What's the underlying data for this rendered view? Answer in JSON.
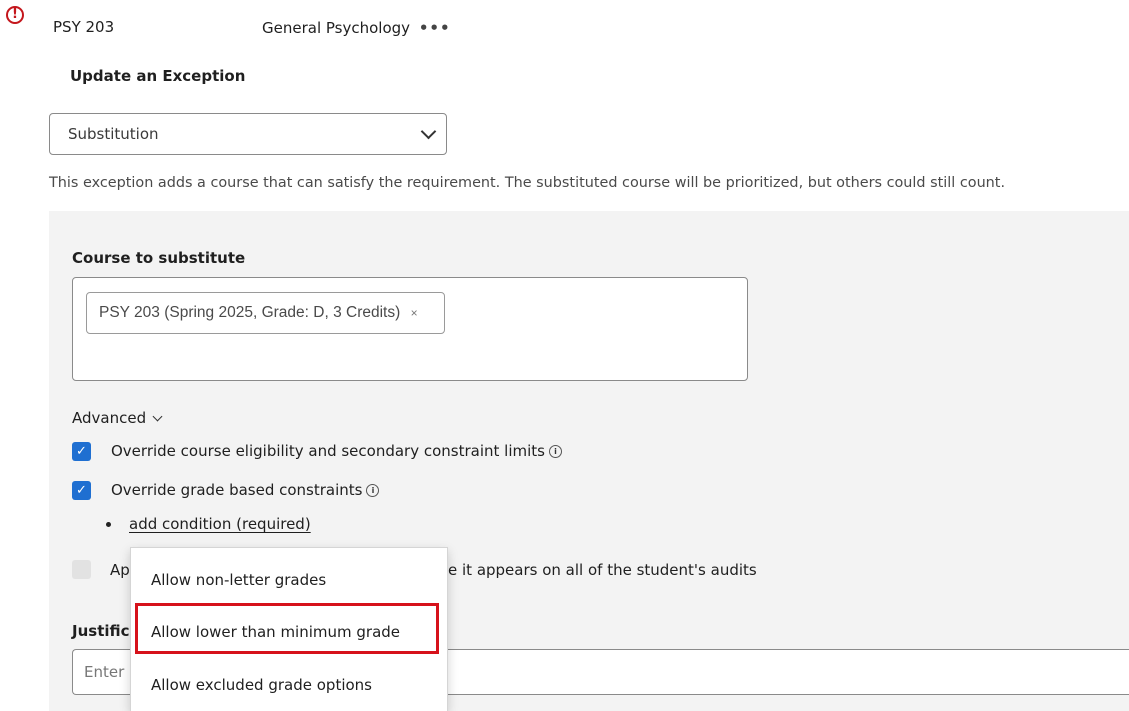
{
  "header": {
    "error_glyph": "!",
    "course_code": "PSY 203",
    "course_name": "General Psychology",
    "more_glyph": "•••"
  },
  "exception": {
    "title": "Update an Exception",
    "type_selected": "Substitution",
    "description": "This exception adds a course that can satisfy the requirement. The substituted course will be prioritized, but others could still count."
  },
  "substitute": {
    "label": "Course to substitute",
    "chip_label": "PSY 203 (Spring 2025, Grade: D, 3 Credits)",
    "chip_remove": "×"
  },
  "advanced": {
    "label": "Advanced",
    "options": [
      {
        "label": "Override course eligibility and secondary constraint limits",
        "checked": true
      },
      {
        "label": "Override grade based constraints",
        "checked": true
      },
      {
        "label_prefix": "Ap",
        "label_suffix": "e it appears on all of the student's audits",
        "checked": false
      }
    ],
    "add_condition": "add condition (required)",
    "check_glyph": "✓",
    "info_glyph": "i"
  },
  "justification": {
    "label_partial": "Justific",
    "placeholder_partial": "Enter"
  },
  "condition_menu": {
    "items": [
      "Allow non-letter grades",
      "Allow lower than minimum grade",
      "Allow excluded grade options"
    ],
    "highlighted_index": 1
  },
  "colors": {
    "error_red": "#c4161c",
    "checkbox_blue": "#1f6fd1",
    "highlight_red": "#d6121b",
    "panel_gray": "#f3f3f3"
  }
}
